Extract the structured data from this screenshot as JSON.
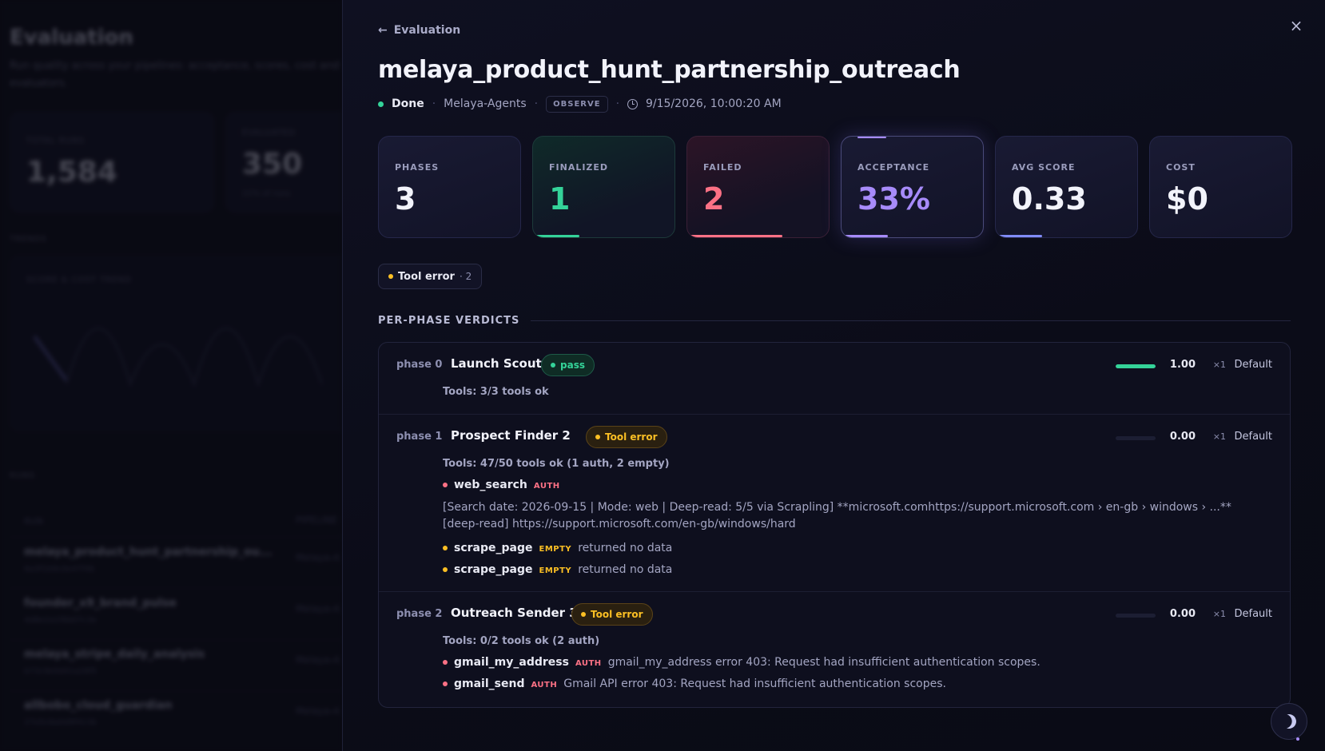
{
  "background": {
    "title": "Evaluation",
    "subtitle": "Run quality across your pipelines: acceptance, scores, cost and evaluators.",
    "cards": [
      {
        "label": "TOTAL RUNS",
        "value": "1,584",
        "note": ""
      },
      {
        "label": "EVALUATED",
        "value": "350",
        "note": "22% of runs"
      }
    ],
    "trends_label": "TRENDS",
    "trend_chart_label": "SCORE & COST TREND",
    "runs_label": "RUNS",
    "runs_header": {
      "name": "RUN",
      "pipeline": "PIPELINE"
    },
    "runs": [
      {
        "name": "melaya_product_hunt_partnership_ou...",
        "id": "6a3f1b9c0e47f4b",
        "pipeline": "Melaya-A"
      },
      {
        "name": "founder_x9_brand_pulse",
        "id": "4d8e2a1f6b07c3e",
        "pipeline": "Melaya-A"
      },
      {
        "name": "melaya_stripe_daily_analysis",
        "id": "b73c9e0d41a28f5",
        "pipeline": "Melaya-A"
      },
      {
        "name": "allbobo_cloud_guardian",
        "id": "27e5c8a0d9f413b",
        "pipeline": "Melaya-A"
      }
    ]
  },
  "drawer": {
    "back_label": "Evaluation",
    "close_icon": "×",
    "title": "melaya_product_hunt_partnership_outreach",
    "status": "Done",
    "pipeline": "Melaya-Agents",
    "mode": "OBSERVE",
    "timestamp": "9/15/2026, 10:00:20 AM",
    "stats": [
      {
        "label": "PHASES",
        "value": "3",
        "bar_fraction": 0,
        "bar_color": ""
      },
      {
        "label": "FINALIZED",
        "value": "1",
        "bar_fraction": 0.33,
        "bar_color": "#34d399"
      },
      {
        "label": "FAILED",
        "value": "2",
        "bar_fraction": 0.67,
        "bar_color": "#fb7185"
      },
      {
        "label": "ACCEPTANCE",
        "value": "33%",
        "bar_fraction": 0.33,
        "bar_color": "#a78bfa"
      },
      {
        "label": "AVG SCORE",
        "value": "0.33",
        "bar_fraction": 0.33,
        "bar_color": "#818cf8"
      },
      {
        "label": "COST",
        "value": "$0",
        "bar_fraction": 0,
        "bar_color": ""
      }
    ],
    "error_chip": {
      "label": "Tool error",
      "count": "· 2"
    },
    "section_title": "PER-PHASE VERDICTS",
    "phases": [
      {
        "num": "phase 0",
        "name": "Launch Scout",
        "verdict": "pass",
        "score_fraction": 1.0,
        "score": "1.00",
        "weight": "×1",
        "profile": "Default",
        "tools_summary": "Tools: 3/3 tools ok"
      },
      {
        "num": "phase 1",
        "name": "Prospect Finder 2",
        "verdict": "Tool error",
        "score_fraction": 0.0,
        "score": "0.00",
        "weight": "×1",
        "profile": "Default",
        "tools_summary": "Tools: 47/50 tools ok (1 auth, 2 empty)",
        "tool_web_search": {
          "name": "web_search",
          "tag": "AUTH",
          "detail": "[Search date: 2026-09-15 | Mode: web | Deep-read: 5/5 via Scrapling] **microsoft.comhttps://support.microsoft.com › en-gb › windows › ...** [deep-read] https://support.microsoft.com/en-gb/windows/hard"
        },
        "tool_scrape_1": {
          "name": "scrape_page",
          "tag": "EMPTY",
          "msg": "returned no data"
        },
        "tool_scrape_2": {
          "name": "scrape_page",
          "tag": "EMPTY",
          "msg": "returned no data"
        }
      },
      {
        "num": "phase 2",
        "name": "Outreach Sender 3",
        "verdict": "Tool error",
        "score_fraction": 0.0,
        "score": "0.00",
        "weight": "×1",
        "profile": "Default",
        "tools_summary": "Tools: 0/2 tools ok (2 auth)",
        "tool_gmail_address": {
          "name": "gmail_my_address",
          "tag": "AUTH",
          "msg": "gmail_my_address error 403: Request had insufficient authentication scopes."
        },
        "tool_gmail_send": {
          "name": "gmail_send",
          "tag": "AUTH",
          "msg": "Gmail API error 403: Request had insufficient authentication scopes."
        }
      }
    ]
  },
  "theme_toggle_icon": "moon-icon"
}
